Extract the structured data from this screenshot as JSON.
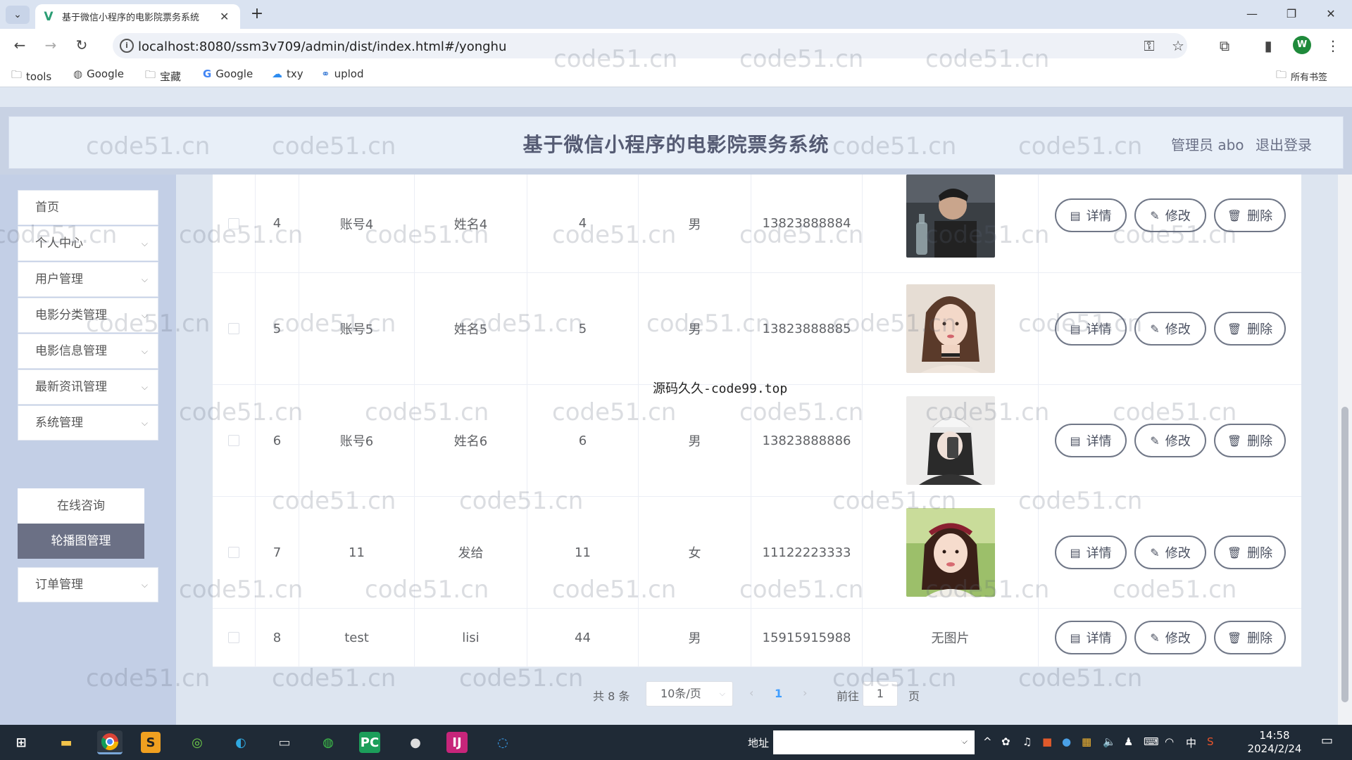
{
  "browser": {
    "tab_title": "基于微信小程序的电影院票务系统",
    "url": "localhost:8080/ssm3v709/admin/dist/index.html#/yonghu",
    "profile_initial": "W",
    "bookmarks": [
      {
        "label": "tools",
        "icon": "folder-icon"
      },
      {
        "label": "Google",
        "icon": "globe-icon"
      },
      {
        "label": "宝藏",
        "icon": "folder-icon"
      },
      {
        "label": "Google",
        "icon": "google-icon"
      },
      {
        "label": "txy",
        "icon": "cloud-icon"
      },
      {
        "label": "uplod",
        "icon": "link-icon"
      }
    ],
    "all_bookmarks": "所有书签"
  },
  "header": {
    "title": "基于微信小程序的电影院票务系统",
    "admin": "管理员 abo",
    "logout": "退出登录"
  },
  "sidebar": {
    "items": [
      {
        "label": "首页"
      },
      {
        "label": "个人中心"
      },
      {
        "label": "用户管理"
      },
      {
        "label": "电影分类管理"
      },
      {
        "label": "电影信息管理"
      },
      {
        "label": "最新资讯管理"
      },
      {
        "label": "系统管理"
      },
      {
        "label": "订单管理"
      }
    ],
    "submenu": [
      "在线咨询",
      "轮播图管理"
    ]
  },
  "table": {
    "rows": [
      {
        "index": "4",
        "account": "账号4",
        "name": "姓名4",
        "age": "4",
        "gender": "男",
        "phone": "13823888884",
        "photo": "man-with-bottle"
      },
      {
        "index": "5",
        "account": "账号5",
        "name": "姓名5",
        "age": "5",
        "gender": "男",
        "phone": "13823888885",
        "photo": "woman-portrait"
      },
      {
        "index": "6",
        "account": "账号6",
        "name": "姓名6",
        "age": "6",
        "gender": "男",
        "phone": "13823888886",
        "photo": "woman-cap-selfie"
      },
      {
        "index": "7",
        "account": "11",
        "name": "发给",
        "age": "11",
        "gender": "女",
        "phone": "11122223333",
        "photo": "girl-headband"
      },
      {
        "index": "8",
        "account": "test",
        "name": "lisi",
        "age": "44",
        "gender": "男",
        "phone": "15915915988",
        "photo_text": "无图片"
      }
    ],
    "actions": {
      "detail": "详情",
      "edit": "修改",
      "delete": "删除"
    }
  },
  "center_watermark": "源码久久-code99.top",
  "watermark_text": "code51.cn",
  "pagination": {
    "total": "共 8 条",
    "page_size": "10条/页",
    "current_page": "1",
    "goto_label": "前往",
    "goto_value": "1",
    "page_suffix": "页"
  },
  "taskbar": {
    "address_label": "地址",
    "time": "14:58",
    "date": "2024/2/24",
    "ime": "中"
  },
  "colors": {
    "header_bg": "#e8eff8",
    "sidebar_bg": "#c3cfe6",
    "submenu_active": "#6b7085",
    "pager_active": "#409eff"
  }
}
